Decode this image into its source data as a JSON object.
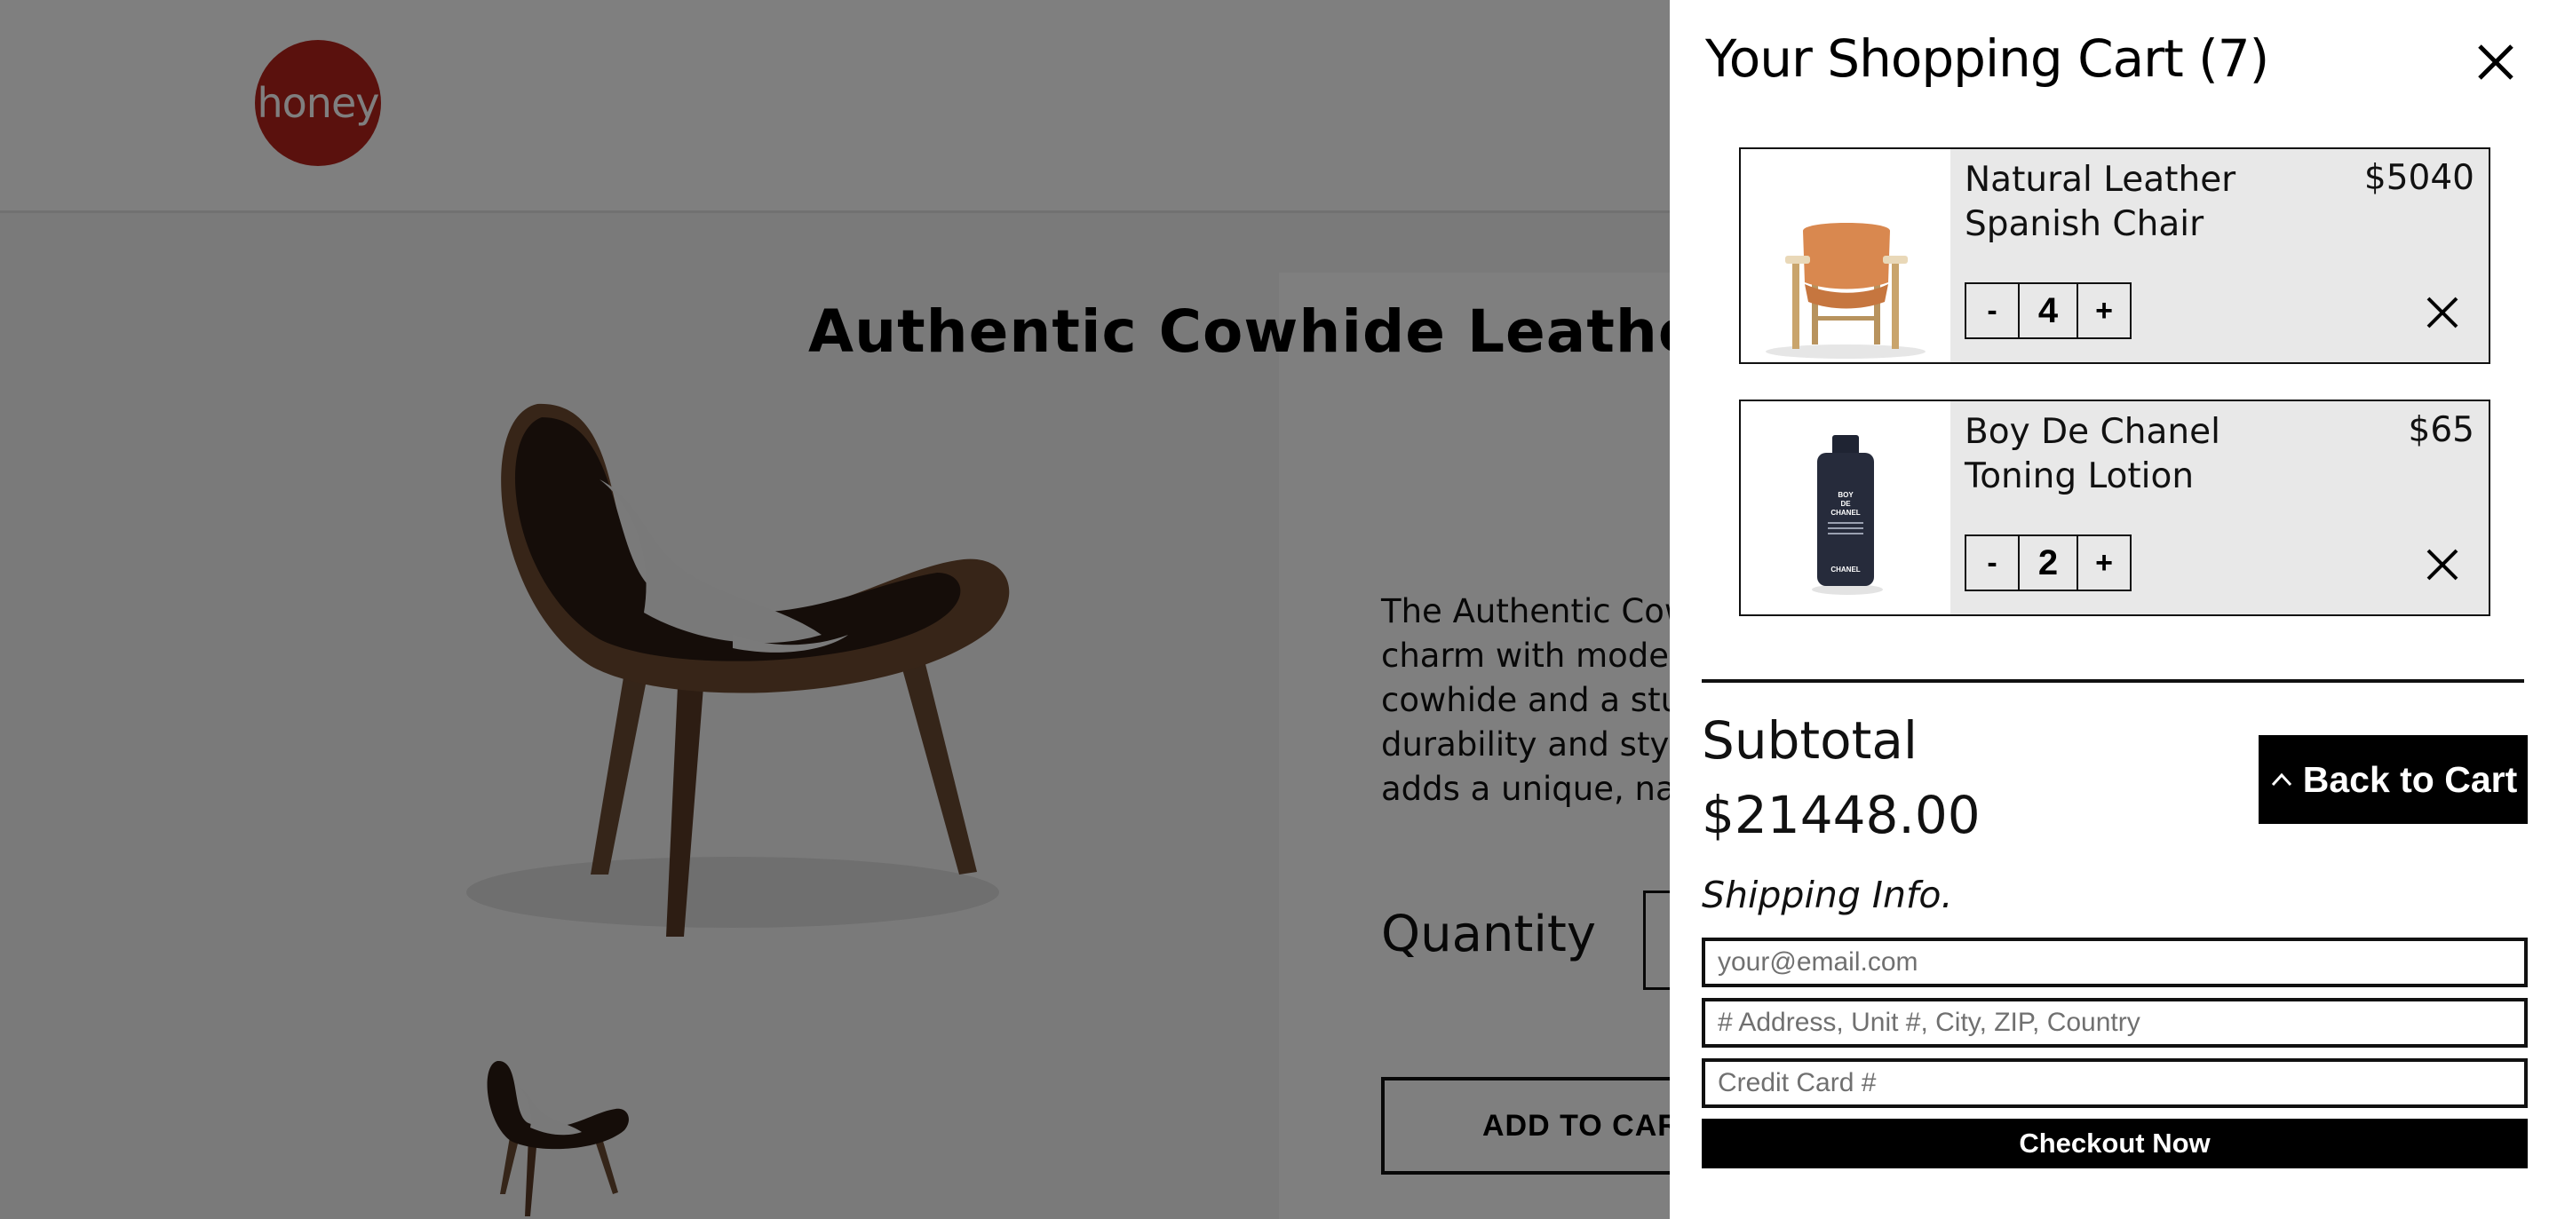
{
  "logo": {
    "text": "honey",
    "color": "#b5221b"
  },
  "product": {
    "title": "Authentic Cowhide Leather Ch",
    "description_lines": [
      "The Authentic Cowh",
      "charm with modern",
      "cowhide and a sturc",
      "durability and style.",
      "adds a unique, natu"
    ],
    "quantity_label": "Quantity",
    "add_to_cart_label": "ADD TO CART"
  },
  "cart": {
    "title": "Your Shopping Cart (7)",
    "items": [
      {
        "name": "Natural Leather Spanish Chair",
        "price": "$5040",
        "quantity": "4",
        "decrement": "-",
        "increment": "+"
      },
      {
        "name": "Boy De Chanel Toning Lotion",
        "price": "$65",
        "quantity": "2",
        "decrement": "-",
        "increment": "+"
      }
    ],
    "lotion_label_lines": [
      "BOY",
      "DE",
      "CHANEL"
    ],
    "lotion_brand": "CHANEL",
    "subtotal_label": "Subtotal",
    "subtotal_value": "$21448.00",
    "back_to_cart_label": "Back to Cart",
    "shipping_label": "Shipping Info.",
    "email_placeholder": "your@email.com",
    "address_placeholder": "# Address, Unit #, City, ZIP, Country",
    "card_placeholder": "Credit Card #",
    "checkout_label": "Checkout Now"
  }
}
